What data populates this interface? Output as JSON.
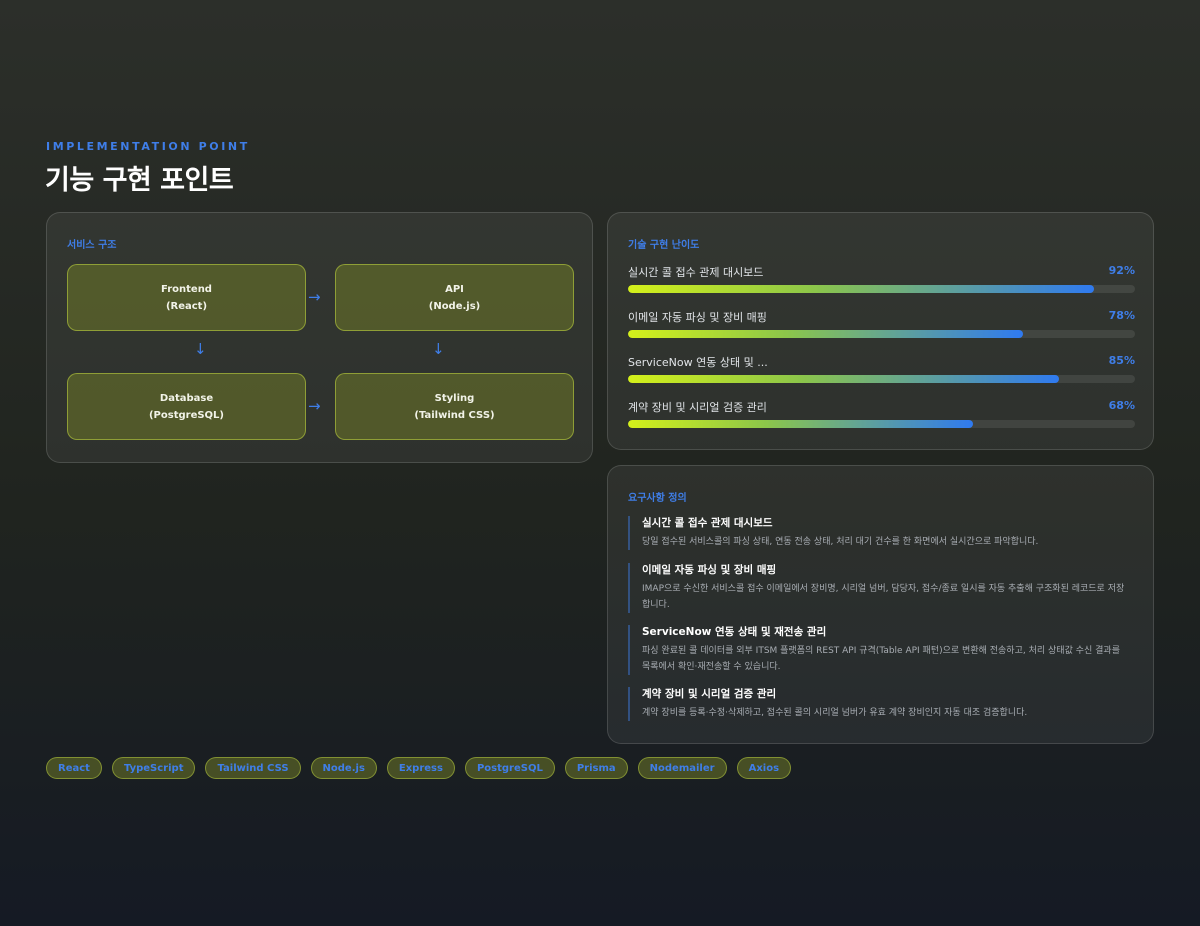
{
  "header": {
    "eyebrow": "IMPLEMENTATION POINT",
    "title": "기능 구현 포인트"
  },
  "architecture": {
    "label": "서비스 구조",
    "nodes": [
      {
        "name": "Frontend",
        "sub": "(React)"
      },
      {
        "name": "API",
        "sub": "(Node.js)"
      },
      {
        "name": "Database",
        "sub": "(PostgreSQL)"
      },
      {
        "name": "Styling",
        "sub": "(Tailwind CSS)"
      }
    ],
    "arrow_right": "→",
    "arrow_down": "↓"
  },
  "difficulty": {
    "label": "기술 구현 난이도",
    "items": [
      {
        "name": "실시간 콜 접수 관제 대시보드",
        "percent": 92,
        "percent_label": "92%"
      },
      {
        "name": "이메일 자동 파싱 및 장비 매핑",
        "percent": 78,
        "percent_label": "78%"
      },
      {
        "name": "ServiceNow 연동 상태 및 ...",
        "percent": 85,
        "percent_label": "85%"
      },
      {
        "name": "계약 장비 및 시리얼 검증 관리",
        "percent": 68,
        "percent_label": "68%"
      }
    ]
  },
  "requirements": {
    "label": "요구사항 정의",
    "items": [
      {
        "title": "실시간 콜 접수 관제 대시보드",
        "desc": "당일 접수된 서비스콜의 파싱 상태, 연동 전송 상태, 처리 대기 건수를 한 화면에서 실시간으로 파악합니다."
      },
      {
        "title": "이메일 자동 파싱 및 장비 매핑",
        "desc": "IMAP으로 수신한 서비스콜 접수 이메일에서 장비명, 시리얼 넘버, 담당자, 접수/종료 일시를 자동 추출해 구조화된 레코드로 저장합니다."
      },
      {
        "title": "ServiceNow 연동 상태 및 재전송 관리",
        "desc": "파싱 완료된 콜 데이터를 외부 ITSM 플랫폼의 REST API 규격(Table API 패턴)으로 변환해 전송하고, 처리 상태값 수신 결과를 목록에서 확인·재전송할 수 있습니다."
      },
      {
        "title": "계약 장비 및 시리얼 검증 관리",
        "desc": "계약 장비를 등록·수정·삭제하고, 접수된 콜의 시리얼 넘버가 유효 계약 장비인지 자동 대조 검증합니다."
      }
    ]
  },
  "tags": [
    "React",
    "TypeScript",
    "Tailwind CSS",
    "Node.js",
    "Express",
    "PostgreSQL",
    "Prisma",
    "Nodemailer",
    "Axios"
  ],
  "colors": {
    "accent": "#3f7ee8",
    "node_fill": "#6e7828",
    "bar_start": "#d4f01a",
    "bar_end": "#2f7af0"
  }
}
